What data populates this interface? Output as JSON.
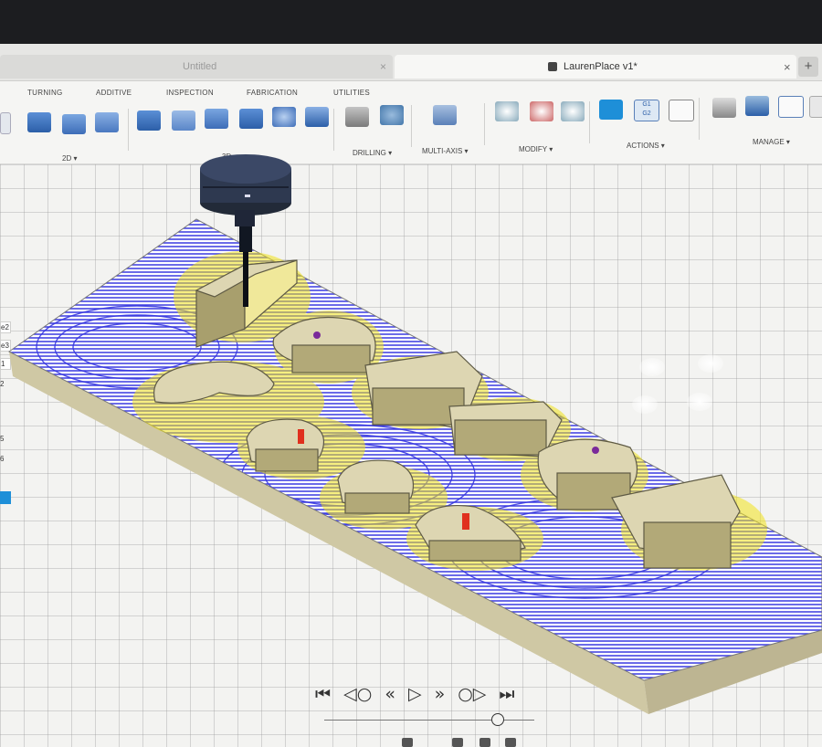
{
  "tabs": {
    "untitled": {
      "label": "Untitled",
      "close": "×"
    },
    "lauren": {
      "label": "LaurenPlace v1*",
      "close": "×"
    },
    "new_tab": "+"
  },
  "ribbon": {
    "categories": [
      "TURNING",
      "ADDITIVE",
      "INSPECTION",
      "FABRICATION",
      "UTILITIES"
    ],
    "groups": {
      "two_d": "2D ▾",
      "three_d": "3D ▾",
      "drilling": "DRILLING ▾",
      "multi_axis": "MULTI-AXIS ▾",
      "modify": "MODIFY ▾",
      "actions": "ACTIONS ▾",
      "manage": "MANAGE ▾"
    },
    "actions_icons": {
      "g1g2": "G1\nG2"
    }
  },
  "sidebar": {
    "tags": [
      "e2",
      "e3",
      "1",
      "2"
    ],
    "numbers": [
      "5",
      "6"
    ]
  },
  "playback": {
    "first": "⏮",
    "prev_op": "◁○",
    "step_back": "«",
    "play": "▷",
    "step_fwd": "»",
    "next_op": "○▷",
    "last": "⏭"
  },
  "colors": {
    "toolpath_blue": "#3a3ae0",
    "toolpath_yellow": "#f0e21a",
    "stock": "#d8d2b0",
    "accent": "#1e8fd8"
  }
}
